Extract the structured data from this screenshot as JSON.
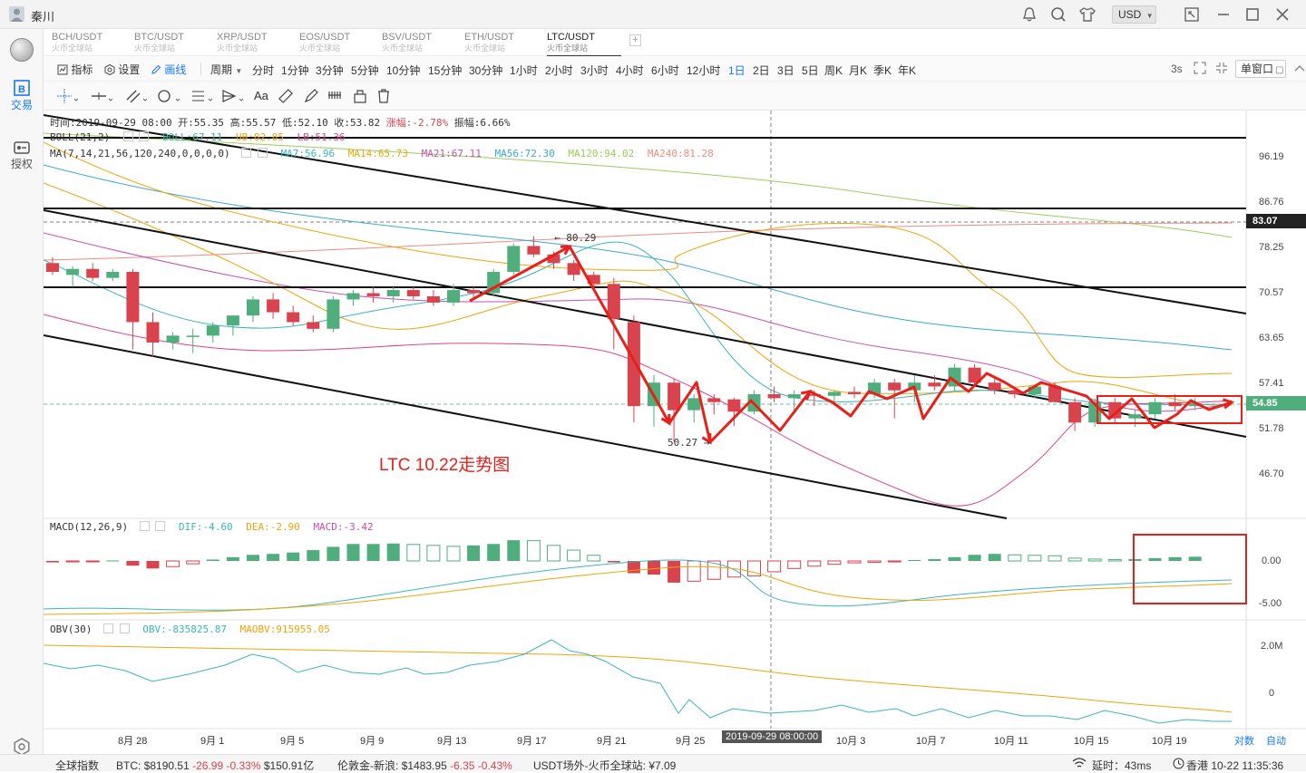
{
  "window": {
    "user": "秦川",
    "currency": "USD",
    "colors": {
      "up": "#4fae7c",
      "down": "#d8434d",
      "accent": "#1677ff",
      "annotation": "#e8201a"
    }
  },
  "sidebar": {
    "items": [
      {
        "label": "交易",
        "icon": "trade-icon"
      },
      {
        "label": "授权",
        "icon": "auth-icon"
      }
    ]
  },
  "tabs": [
    {
      "label": "BCH/USDT",
      "sub": "火币全球站"
    },
    {
      "label": "BTC/USDT",
      "sub": "火币全球站"
    },
    {
      "label": "XRP/USDT",
      "sub": "火币全球站"
    },
    {
      "label": "EOS/USDT",
      "sub": "火币全球站"
    },
    {
      "label": "BSV/USDT",
      "sub": "火币全球站"
    },
    {
      "label": "ETH/USDT",
      "sub": "火币全球站"
    },
    {
      "label": "LTC/USDT",
      "sub": "火币全球站",
      "active": true
    }
  ],
  "toolbar": {
    "indicator": "指标",
    "settings": "设置",
    "draw": "画线",
    "period_label": "周期",
    "periods": [
      "分时",
      "1分钟",
      "3分钟",
      "5分钟",
      "10分钟",
      "15分钟",
      "30分钟",
      "1小时",
      "2小时",
      "3小时",
      "4小时",
      "6小时",
      "12小时",
      "1日",
      "2日",
      "3日",
      "5日",
      "周K",
      "月K",
      "季K",
      "年K"
    ],
    "selected_period": "1日",
    "refresh": "3s",
    "window_mode": "单窗口",
    "font_tool": "Aa"
  },
  "info": {
    "time": "时间:2019-09-29 08:00",
    "open": "开:55.35",
    "high": "高:55.57",
    "low": "低:52.10",
    "close": "收:53.82",
    "change": "涨幅:-2.78%",
    "amp": "振幅:6.66%"
  },
  "boll": {
    "title": "BOLL(21,2)",
    "boll": "BOLL:67.11",
    "ub": "UB:82.85",
    "lb": "LB:51.36"
  },
  "ma": {
    "title": "MA(7,14,21,56,120,240,0,0,0,0)",
    "values": [
      {
        "label": "MA7:56.96",
        "color": "#3ab5c2"
      },
      {
        "label": "MA14:65.73",
        "color": "#f0a30a"
      },
      {
        "label": "MA21:67.11",
        "color": "#c94fb3"
      },
      {
        "label": "MA56:72.30",
        "color": "#38a8d8"
      },
      {
        "label": "MA120:94.02",
        "color": "#9acd5a"
      },
      {
        "label": "MA240:81.28",
        "color": "#f08a7e"
      }
    ]
  },
  "macd": {
    "title": "MACD(12,26,9)",
    "dif": "DIF:-4.60",
    "dea": "DEA:-2.90",
    "macd": "MACD:-3.42"
  },
  "obv": {
    "title": "OBV(30)",
    "obv": "OBV:-835825.87",
    "maobv": "MAOBV:915955.05"
  },
  "price_axis": [
    "96.19",
    "86.76",
    "78.25",
    "70.57",
    "63.65",
    "57.41",
    "51.78",
    "46.70"
  ],
  "price_tags": {
    "high_line": "83.07",
    "current": "54.85"
  },
  "macd_axis": [
    "0.00",
    "-5.00"
  ],
  "obv_axis": [
    "2.0M",
    "0"
  ],
  "x_axis": [
    "8月 28",
    "9月 1",
    "9月 5",
    "9月 9",
    "9月 13",
    "9月 17",
    "9月 21",
    "9月 25",
    "10月 3",
    "10月 7",
    "10月 11",
    "10月 15",
    "10月 19"
  ],
  "crosshair_time": "2019-09-29 08:00:00",
  "markers": {
    "high": "← 80.29",
    "low": "50.27 →"
  },
  "annotation": "LTC 10.22走势图",
  "bottom_buttons": {
    "log": "对数",
    "auto": "自动"
  },
  "status": {
    "index": "全球指数",
    "btc_label": "BTC:",
    "btc_price": "$8190.51",
    "btc_change": "-26.99",
    "btc_pct": "-0.33%",
    "btc_vol": "$150.91亿",
    "gold_label": "伦敦金-新浪:",
    "gold_price": "$1483.95",
    "gold_change": "-6.35",
    "gold_pct": "-0.43%",
    "usdt": "USDT场外-火币全球站: ¥7.09",
    "latency": "延时：43ms",
    "clock": "香港 10-22 11:35:36"
  },
  "chart_data": {
    "type": "candlestick",
    "symbol": "LTC/USDT",
    "price_range": [
      44,
      100
    ],
    "days": [
      "08-26",
      "08-27",
      "08-28",
      "08-29",
      "08-30",
      "08-31",
      "09-01",
      "09-02",
      "09-03",
      "09-04",
      "09-05",
      "09-06",
      "09-07",
      "09-08",
      "09-09",
      "09-10",
      "09-11",
      "09-12",
      "09-13",
      "09-14",
      "09-15",
      "09-16",
      "09-17",
      "09-18",
      "09-19",
      "09-20",
      "09-21",
      "09-22",
      "09-23",
      "09-24",
      "09-25",
      "09-26",
      "09-27",
      "09-28",
      "09-29",
      "09-30",
      "10-01",
      "10-02",
      "10-03",
      "10-04",
      "10-05",
      "10-06",
      "10-07",
      "10-08",
      "10-09",
      "10-10",
      "10-11",
      "10-12",
      "10-13",
      "10-14",
      "10-15",
      "10-16",
      "10-17",
      "10-18",
      "10-19",
      "10-20",
      "10-21",
      "10-22"
    ],
    "ohlc": [
      [
        75.5,
        76.5,
        73.5,
        74.0
      ],
      [
        73.5,
        75.0,
        71.5,
        74.5
      ],
      [
        74.5,
        75.5,
        72.5,
        73.0
      ],
      [
        73.0,
        74.5,
        72.5,
        74.0
      ],
      [
        74.0,
        74.5,
        62.0,
        66.0
      ],
      [
        66.0,
        67.5,
        61.0,
        63.0
      ],
      [
        63.0,
        64.5,
        62.0,
        64.0
      ],
      [
        64.0,
        65.0,
        61.5,
        64.0
      ],
      [
        64.0,
        66.0,
        63.0,
        65.5
      ],
      [
        65.5,
        67.0,
        64.0,
        67.0
      ],
      [
        67.0,
        70.0,
        66.0,
        69.5
      ],
      [
        69.5,
        70.5,
        66.5,
        67.5
      ],
      [
        67.5,
        68.5,
        65.5,
        66.0
      ],
      [
        66.0,
        67.0,
        64.5,
        65.0
      ],
      [
        65.0,
        70.0,
        64.5,
        69.5
      ],
      [
        69.5,
        71.0,
        68.5,
        70.5
      ],
      [
        70.5,
        71.5,
        69.0,
        70.0
      ],
      [
        70.0,
        71.5,
        69.0,
        71.0
      ],
      [
        71.0,
        71.5,
        69.5,
        70.0
      ],
      [
        70.0,
        71.0,
        68.5,
        69.0
      ],
      [
        69.0,
        72.0,
        68.5,
        71.0
      ],
      [
        71.0,
        71.5,
        69.5,
        70.5
      ],
      [
        70.5,
        74.5,
        70.0,
        74.0
      ],
      [
        74.0,
        79.0,
        73.5,
        78.5
      ],
      [
        78.5,
        80.29,
        76.5,
        77.0
      ],
      [
        77.0,
        77.5,
        74.5,
        75.5
      ],
      [
        75.5,
        76.0,
        72.5,
        73.5
      ],
      [
        73.5,
        74.0,
        71.0,
        72.0
      ],
      [
        72.0,
        73.0,
        62.0,
        66.5
      ],
      [
        66.0,
        67.0,
        52.5,
        54.5
      ],
      [
        54.5,
        58.5,
        52.0,
        57.5
      ],
      [
        57.5,
        58.0,
        50.27,
        54.0
      ],
      [
        54.0,
        56.0,
        52.5,
        55.5
      ],
      [
        55.5,
        56.0,
        53.5,
        55.0
      ],
      [
        55.35,
        55.57,
        52.1,
        53.82
      ],
      [
        53.82,
        56.5,
        53.5,
        56.0
      ],
      [
        56.0,
        57.0,
        55.0,
        55.5
      ],
      [
        55.5,
        56.5,
        54.0,
        56.0
      ],
      [
        56.0,
        56.5,
        54.5,
        55.8
      ],
      [
        55.8,
        56.5,
        54.5,
        56.3
      ],
      [
        56.3,
        57.0,
        55.5,
        56.0
      ],
      [
        56.0,
        58.0,
        55.5,
        57.5
      ],
      [
        57.5,
        58.0,
        53.0,
        56.5
      ],
      [
        56.5,
        58.5,
        55.0,
        57.5
      ],
      [
        57.5,
        58.5,
        56.5,
        57.0
      ],
      [
        57.0,
        60.0,
        56.5,
        59.5
      ],
      [
        59.5,
        60.0,
        57.0,
        57.5
      ],
      [
        57.5,
        58.0,
        56.0,
        56.5
      ],
      [
        56.5,
        57.0,
        55.5,
        56.0
      ],
      [
        56.0,
        57.0,
        55.5,
        57.0
      ],
      [
        57.0,
        57.5,
        55.0,
        55.0
      ],
      [
        55.0,
        55.5,
        51.5,
        52.5
      ],
      [
        52.5,
        55.5,
        52.0,
        55.0
      ],
      [
        55.0,
        55.5,
        52.5,
        53.0
      ],
      [
        53.0,
        54.0,
        52.0,
        53.5
      ],
      [
        53.5,
        55.5,
        53.0,
        55.0
      ],
      [
        55.0,
        56.0,
        54.0,
        54.5
      ],
      [
        54.5,
        55.5,
        54.0,
        54.85
      ]
    ],
    "macd_hist": [
      -0.3,
      -0.2,
      -0.1,
      0.1,
      -1.0,
      -1.6,
      -1.2,
      -0.6,
      0.3,
      0.8,
      1.3,
      1.5,
      1.8,
      2.3,
      3.0,
      3.6,
      3.6,
      3.7,
      3.5,
      3.3,
      3.1,
      3.3,
      3.6,
      4.4,
      4.3,
      3.3,
      2.3,
      1.2,
      -0.3,
      -2.6,
      -2.9,
      -4.6,
      -4.3,
      -3.9,
      -3.42,
      -3.2,
      -2.3,
      -1.6,
      -1.1,
      -0.7,
      -0.4,
      -0.3,
      -0.2,
      0.2,
      0.4,
      0.8,
      1.3,
      1.5,
      1.3,
      1.2,
      1.1,
      0.6,
      0.4,
      0.3,
      0.4,
      0.6,
      0.8,
      0.9
    ]
  }
}
